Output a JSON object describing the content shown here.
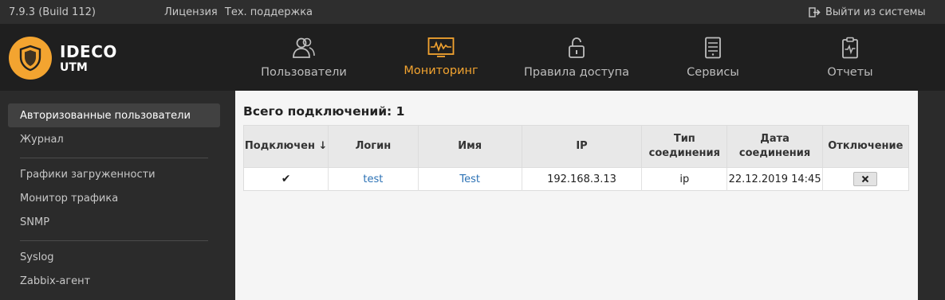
{
  "topbar": {
    "version": "7.9.3 (Build 112)",
    "license": "Лицензия",
    "support": "Тех. поддержка",
    "logout": "Выйти из системы"
  },
  "logo": {
    "line1": "IDECO",
    "line2": "UTM"
  },
  "nav": {
    "users": "Пользователи",
    "monitoring": "Мониторинг",
    "access_rules": "Правила доступа",
    "services": "Сервисы",
    "reports": "Отчеты"
  },
  "sidebar": {
    "items": [
      "Авторизованные пользователи",
      "Журнал",
      "Графики загруженности",
      "Монитор трафика",
      "SNMP",
      "Syslog",
      "Zabbix-агент"
    ]
  },
  "main": {
    "title": "Всего подключений: 1",
    "columns": [
      "Подключен ↓",
      "Логин",
      "Имя",
      "IP",
      "Тип соединения",
      "Дата соединения",
      "Отключение"
    ],
    "rows": [
      {
        "connected": "✔",
        "login": "test",
        "name": "Test",
        "ip": "192.168.3.13",
        "type": "ip",
        "date": "22.12.2019 14:45"
      }
    ]
  },
  "colors": {
    "accent": "#f3a430",
    "link": "#2c72b5",
    "dark": "#1f1f1f"
  },
  "icons": [
    "logout-icon",
    "shield-logo-icon",
    "users-icon",
    "monitoring-icon",
    "lock-icon",
    "server-icon",
    "clipboard-icon",
    "check-icon",
    "close-icon"
  ]
}
